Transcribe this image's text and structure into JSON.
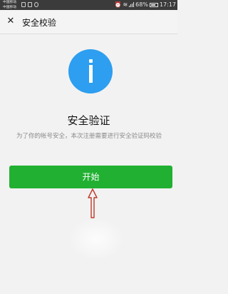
{
  "status_bar": {
    "carrier_1": "中国移动",
    "carrier_2": "中国移动",
    "battery": "68%",
    "time": "17:17"
  },
  "app_bar": {
    "close_glyph": "✕",
    "title": "安全校验"
  },
  "main": {
    "icon": "info-icon",
    "heading": "安全验证",
    "description": "为了你的帐号安全，本次注册需要进行安全验证码校验"
  },
  "start_button": {
    "label": "开始"
  },
  "colors": {
    "accent": "#21b031",
    "info": "#2d9ef0",
    "annotation": "#c0392b"
  }
}
